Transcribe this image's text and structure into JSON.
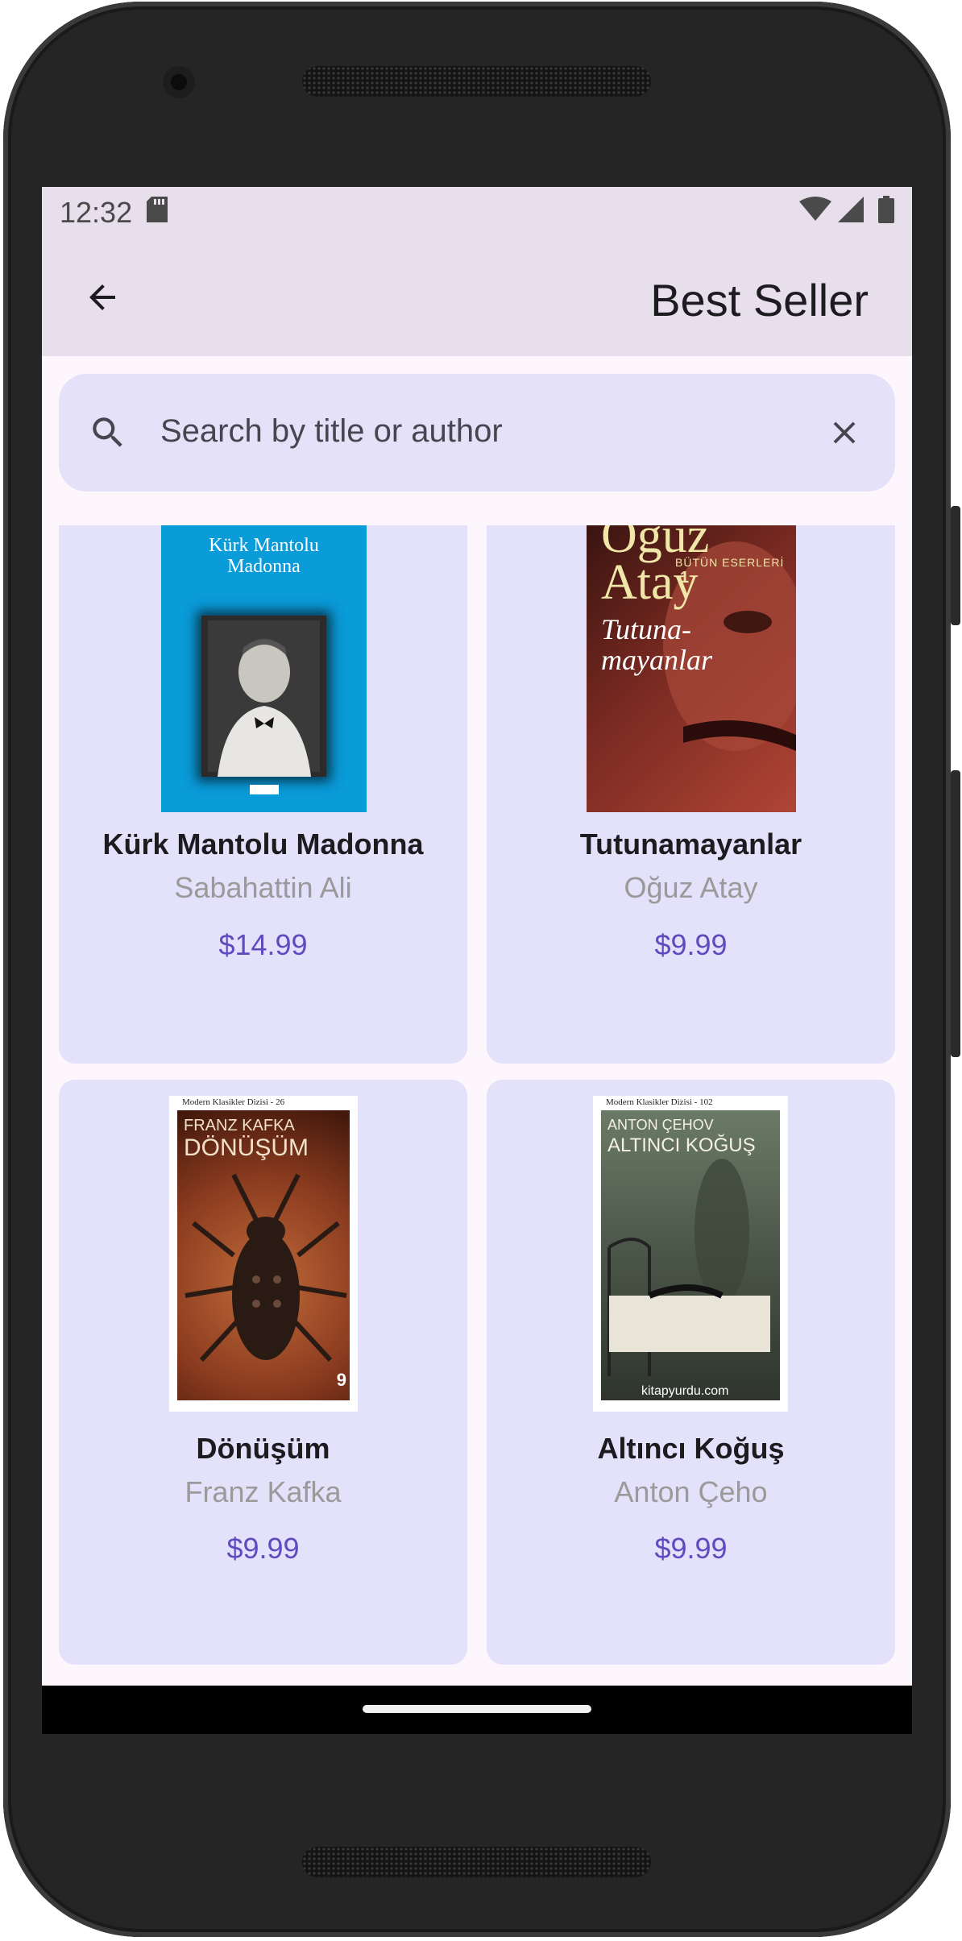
{
  "status_bar": {
    "time": "12:32",
    "icons": [
      "sd-card-icon",
      "wifi-icon",
      "signal-icon",
      "battery-icon"
    ]
  },
  "app_bar": {
    "back_icon": "arrow-back-icon",
    "title": "Best Seller"
  },
  "search": {
    "placeholder": "Search by title or author",
    "search_icon": "search-icon",
    "clear_icon": "close-icon"
  },
  "books": [
    {
      "title": "Kürk Mantolu Madonna",
      "author": "Sabahattin Ali",
      "price": "$14.99",
      "cover": {
        "line1": "Kürk Mantolu",
        "line2": "Madonna",
        "bg": "#0a9bd9"
      }
    },
    {
      "title": "Tutunamayanlar",
      "author": "Oğuz Atay",
      "price": "$9.99",
      "cover": {
        "line1": "Oğuz",
        "line2": "Atay",
        "sub": "BÜTÜN ESERLERİ",
        "num": "1",
        "line3": "Tutuna-",
        "line4": "mayanlar",
        "bg": "#7a2a22"
      }
    },
    {
      "title": "Dönüşüm",
      "author": "Franz Kafka",
      "price": "$9.99",
      "cover": {
        "header": "Modern Klasikler Dizisi - 26",
        "line1": "FRANZ KAFKA",
        "line2": "DÖNÜŞÜM",
        "num": "9",
        "bg": "#8a3b1f"
      }
    },
    {
      "title": "Altıncı Koğuş",
      "author": "Anton Çeho",
      "price": "$9.99",
      "cover": {
        "header": "Modern Klasikler Dizisi - 102",
        "line1": "ANTON ÇEHOV",
        "line2": "ALTINCI KOĞUŞ",
        "watermark": "kitapyurdu.com",
        "bg": "#3e4a3c"
      }
    }
  ],
  "colors": {
    "app_bar_bg": "#e7e0ec",
    "card_bg": "#e4e2fa",
    "price": "#5e4bbf",
    "screen_bg": "#fdf7fd"
  }
}
